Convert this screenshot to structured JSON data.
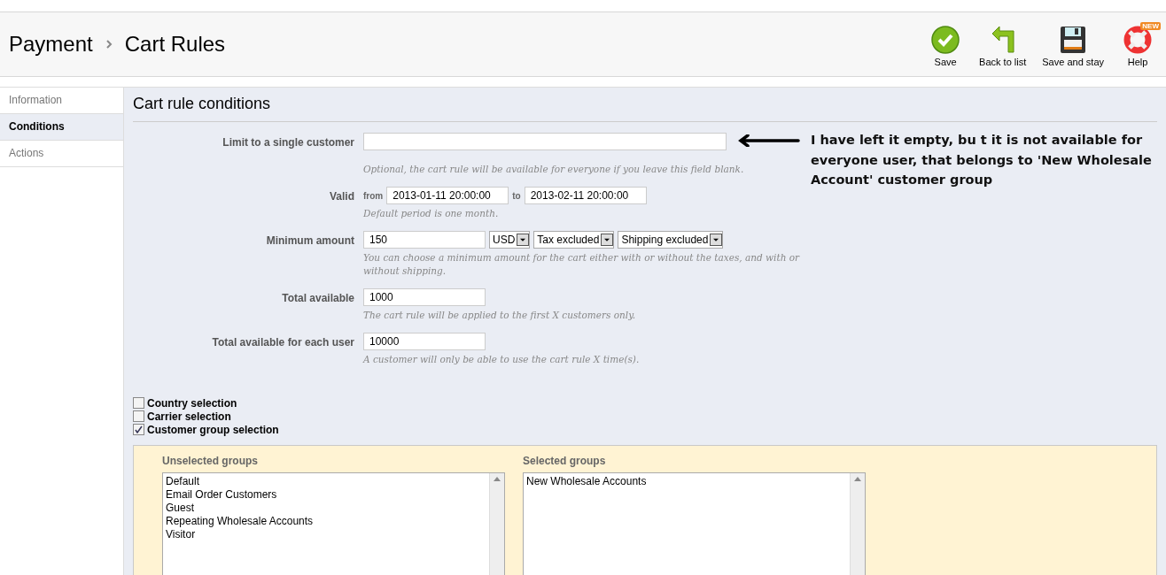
{
  "header": {
    "breadcrumb": [
      "Payment",
      "Cart Rules"
    ],
    "toolbar": [
      {
        "kind": "save",
        "label": "Save"
      },
      {
        "kind": "back",
        "label": "Back to list"
      },
      {
        "kind": "stay",
        "label": "Save and stay"
      },
      {
        "kind": "help",
        "label": "Help",
        "badge": "NEW"
      }
    ]
  },
  "sidebar": {
    "items": [
      {
        "label": "Information",
        "selected": false
      },
      {
        "label": "Conditions",
        "selected": true
      },
      {
        "label": "Actions",
        "selected": false
      }
    ]
  },
  "panel": {
    "title": "Cart rule conditions",
    "fields": [
      {
        "kind": "wide_text",
        "label": "Limit to a single customer",
        "help": "Optional, the cart rule will be available for everyone if you leave this field blank."
      },
      {
        "kind": "daterange",
        "label": "Valid",
        "from_label": "from",
        "from": "2013-01-11 20:00:00",
        "to_label": "to",
        "to": "2013-02-11 20:00:00",
        "help": "Default period is one month."
      },
      {
        "kind": "amount",
        "label": "Minimum amount",
        "value": "150",
        "selects": [
          "USD",
          "Tax excluded",
          "Shipping excluded"
        ],
        "help": "You can choose a minimum amount for the cart either with or without the taxes, and with or without shipping."
      },
      {
        "kind": "text",
        "label": "Total available",
        "value": "1000",
        "help": "The cart rule will be applied to the first X customers only."
      },
      {
        "kind": "text",
        "label": "Total available for each user",
        "value": "10000",
        "help": "A customer will only be able to use the cart rule X time(s)."
      }
    ],
    "checkboxes": [
      {
        "label": "Country selection",
        "checked": false
      },
      {
        "label": "Carrier selection",
        "checked": false
      },
      {
        "label": "Customer group selection",
        "checked": true
      }
    ],
    "groups": {
      "unselected_label": "Unselected groups",
      "unselected": [
        "Default",
        "Email Order Customers",
        "Guest",
        "Repeating Wholesale Accounts",
        "Visitor"
      ],
      "selected_label": "Selected groups",
      "selected": [
        "New Wholesale Accounts"
      ]
    }
  },
  "annotation": "I have left it empty, bu t it is not available for everyone user, that belongs to 'New Wholesale Account' customer group"
}
